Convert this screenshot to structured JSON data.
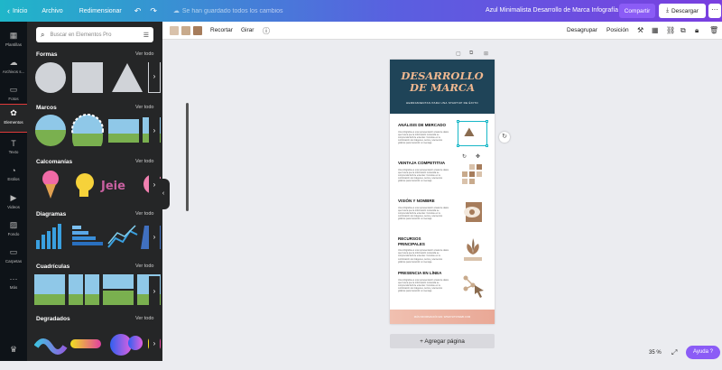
{
  "topbar": {
    "home": "Inicio",
    "file": "Archivo",
    "resize": "Redimensionar",
    "saved_status": "Se han guardado todos los cambios",
    "doc_title": "Azul Minimalista Desarrollo de Marca Infografía",
    "share": "Compartir",
    "download": "Descargar"
  },
  "sidebar": {
    "items": [
      {
        "label": "Plantillas",
        "icon": "layout-icon"
      },
      {
        "label": "Archivos s...",
        "icon": "upload-icon"
      },
      {
        "label": "Fotos",
        "icon": "photo-icon"
      },
      {
        "label": "Elementos",
        "icon": "elements-icon"
      },
      {
        "label": "Texto",
        "icon": "text-icon"
      },
      {
        "label": "Estilos",
        "icon": "styles-icon"
      },
      {
        "label": "Videos",
        "icon": "video-icon"
      },
      {
        "label": "Fondo",
        "icon": "background-icon"
      },
      {
        "label": "Carpetas",
        "icon": "folder-icon"
      },
      {
        "label": "Más",
        "icon": "more-icon"
      }
    ]
  },
  "panel": {
    "search_placeholder": "Buscar en Elementos Pro",
    "see_all": "Ver todo",
    "sections": [
      "Formas",
      "Marcos",
      "Calcomanías",
      "Diagramas",
      "Cuadrículas",
      "Degradados"
    ]
  },
  "toolbar": {
    "swatches": [
      "#d9c2ab",
      "#c8aa8c",
      "#a67c5b"
    ],
    "crop": "Recortar",
    "flip": "Girar",
    "ungroup": "Desagrupar",
    "position": "Posición"
  },
  "page": {
    "title_line1": "DESARROLLO",
    "title_line2": "DE MARCA",
    "subtitle": "HERRAMIENTAS PARA UNA STARTUP DE ÉXITO",
    "body_text": "Una infografía es una representación visual de datos que busca que la información contenida se comprenda fácil de entender. Consiste en la combinación de imágenes, textos y elementos gráficos para transmitir un mensaje.",
    "rows": [
      {
        "title": "ANÁLISIS DE MERCADO"
      },
      {
        "title": "VENTAJA COMPETITIVA"
      },
      {
        "title": "VISIÓN Y NOMBRE"
      },
      {
        "title": "RECURSOS PRINCIPALES"
      },
      {
        "title": "PRESENCIA EN LÍNEA"
      }
    ],
    "footer": "MÁS INFORMACIÓN EN: WWW.SITIOWEB.COM"
  },
  "add_page": "+ Agregar página",
  "zoom": "35 %",
  "help": "Ayuda ?"
}
